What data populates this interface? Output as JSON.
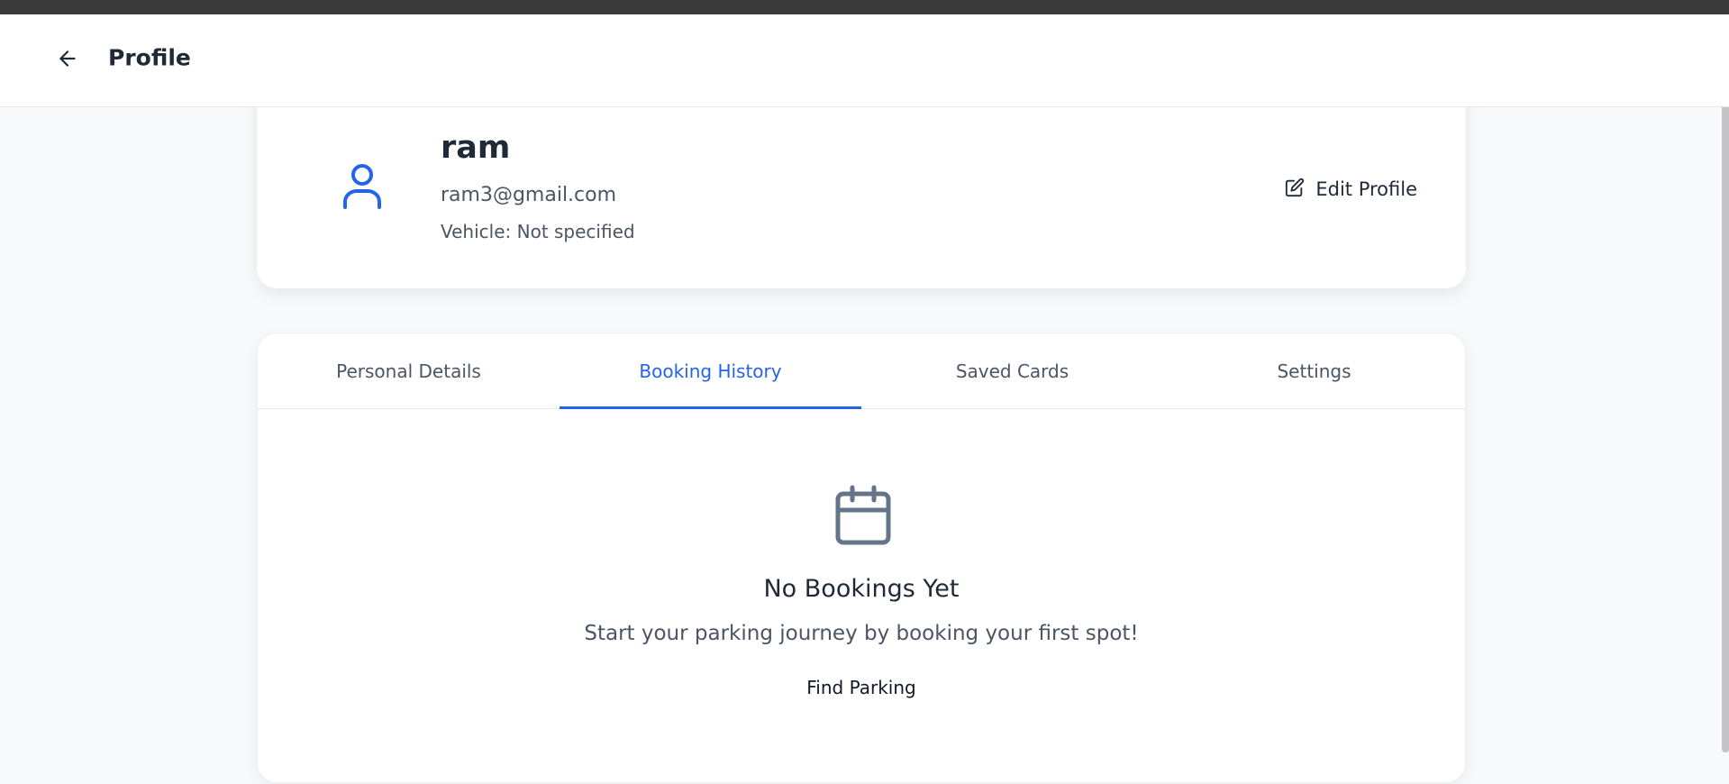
{
  "header": {
    "title": "Profile",
    "back_icon": "arrow-left-icon"
  },
  "profile": {
    "name": "ram",
    "email": "ram3@gmail.com",
    "vehicle": "Vehicle: Not specified",
    "avatar_icon": "user-icon",
    "edit_label": "Edit Profile",
    "edit_icon": "edit-icon"
  },
  "tabs": [
    {
      "label": "Personal Details",
      "active": false
    },
    {
      "label": "Booking History",
      "active": true
    },
    {
      "label": "Saved Cards",
      "active": false
    },
    {
      "label": "Settings",
      "active": false
    }
  ],
  "empty_state": {
    "icon": "calendar-icon",
    "title": "No Bookings Yet",
    "subtitle": "Start your parking journey by booking your first spot!",
    "button_label": "Find Parking"
  },
  "colors": {
    "accent": "#2563eb",
    "background": "#f8f9fa",
    "card": "#ffffff",
    "muted_text": "#4b5563",
    "icon_gray": "#64748b"
  }
}
